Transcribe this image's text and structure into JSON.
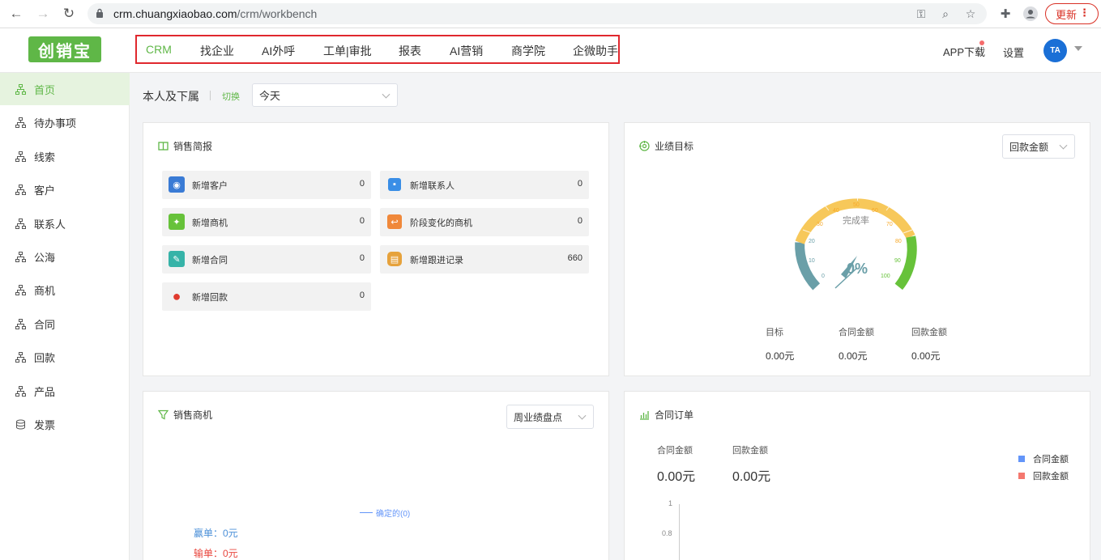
{
  "browser": {
    "url_host": "crm.chuangxiaobao.com",
    "url_path": "/crm/workbench",
    "update_label": "更新",
    "icons": [
      "back-icon",
      "forward-icon",
      "reload-icon",
      "lock-icon",
      "key-icon",
      "zoom-icon",
      "star-icon",
      "puzzle-icon",
      "profile-icon",
      "menu-dots-icon"
    ]
  },
  "header": {
    "logo_text": "创销宝",
    "nav": [
      {
        "label": "CRM",
        "active": true
      },
      {
        "label": "找企业"
      },
      {
        "label": "AI外呼"
      },
      {
        "label": "工单|审批"
      },
      {
        "label": "报表"
      },
      {
        "label": "AI营销"
      },
      {
        "label": "商学院"
      },
      {
        "label": "企微助手"
      }
    ],
    "app_download": "APP下载",
    "settings": "设置",
    "avatar_text": "TA"
  },
  "sidebar": {
    "items": [
      {
        "label": "首页",
        "active": true
      },
      {
        "label": "待办事项"
      },
      {
        "label": "线索"
      },
      {
        "label": "客户"
      },
      {
        "label": "联系人"
      },
      {
        "label": "公海"
      },
      {
        "label": "商机"
      },
      {
        "label": "合同"
      },
      {
        "label": "回款"
      },
      {
        "label": "产品"
      },
      {
        "label": "发票"
      }
    ]
  },
  "filter": {
    "scope_label": "本人及下属",
    "switch_label": "切换",
    "period_value": "今天"
  },
  "sales_brief": {
    "title": "销售简报",
    "stats": [
      {
        "label": "新增客户",
        "value": "0",
        "color": "#3a7bd5"
      },
      {
        "label": "新增联系人",
        "value": "0",
        "color": "#3a8ee6"
      },
      {
        "label": "新增商机",
        "value": "0",
        "color": "#67c23a"
      },
      {
        "label": "阶段变化的商机",
        "value": "0",
        "color": "#f0883a"
      },
      {
        "label": "新增合同",
        "value": "0",
        "color": "#36b3a8"
      },
      {
        "label": "新增跟进记录",
        "value": "660",
        "color": "#e6a23c"
      },
      {
        "label": "新增回款",
        "value": "0",
        "color": "#e03b2f"
      }
    ]
  },
  "performance": {
    "title": "业绩目标",
    "select_value": "回款金额",
    "gauge_label": "完成率",
    "gauge_value": "0%",
    "gauge_ticks": [
      "0",
      "10",
      "20",
      "30",
      "40",
      "50",
      "60",
      "70",
      "80",
      "90",
      "100"
    ],
    "columns": [
      {
        "label": "目标",
        "value": "0.00元"
      },
      {
        "label": "合同金额",
        "value": "0.00元"
      },
      {
        "label": "回款金额",
        "value": "0.00元"
      }
    ]
  },
  "sales_opportunity": {
    "title": "销售商机",
    "select_value": "周业绩盘点",
    "legend": "确定的(0)",
    "win": "赢单：0元",
    "lose": "输单：0元"
  },
  "contract_orders": {
    "title": "合同订单",
    "contract_label": "合同金额",
    "contract_value": "0.00元",
    "payment_label": "回款金额",
    "payment_value": "0.00元",
    "legend": [
      {
        "label": "合同金额",
        "color": "#6395f9"
      },
      {
        "label": "回款金额",
        "color": "#f4786f"
      }
    ],
    "y_ticks": [
      "1",
      "0.8"
    ]
  }
}
